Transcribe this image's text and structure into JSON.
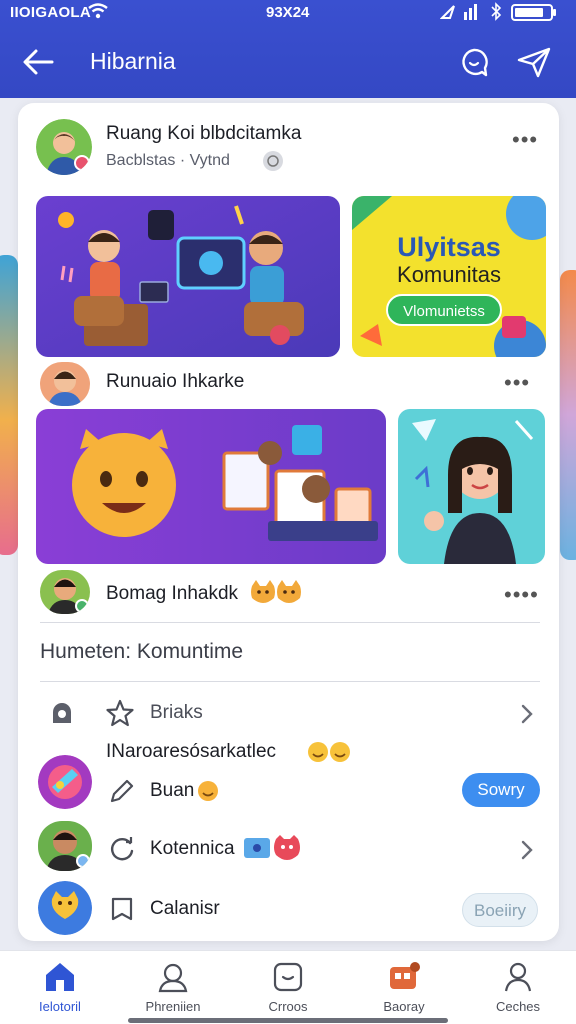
{
  "status_bar": {
    "carrier": "IIOIGAOLA",
    "time": "93X24",
    "icons": [
      "wifi-icon",
      "location-icon",
      "signal-icon",
      "bluetooth-icon",
      "battery-icon"
    ]
  },
  "header": {
    "title": "Hibarnia",
    "icons": [
      "back-arrow-icon",
      "chat-icon",
      "send-icon"
    ]
  },
  "posts": [
    {
      "title": "Ruang Koi blbdcitamka",
      "subtitle": "Bacblstas · Vytnd",
      "tiles": [
        {
          "kind": "illustration",
          "scene": "friends-with-computer"
        },
        {
          "kind": "promo",
          "heading": "Ulyitsas",
          "subheading": "Komunitas",
          "button": "Vlomunietss"
        }
      ]
    },
    {
      "title": "Runuaio Ihkarke",
      "tiles": [
        {
          "kind": "illustration",
          "scene": "emoji-and-documents"
        },
        {
          "kind": "illustration",
          "scene": "girl-with-music"
        }
      ]
    },
    {
      "title": "Bomag Inhakdk",
      "emoji": [
        "cat-face-icon",
        "cat-face-icon"
      ]
    }
  ],
  "section_title": "Humeten:  Komuntime",
  "list": [
    {
      "label": "Briaks",
      "left_icon": "person-silhouette-icon",
      "icon": "star-icon",
      "chevron": true
    },
    {
      "heading": "INaroaresósarkatlec",
      "label": "Buan",
      "icon": "pen-icon",
      "badge": "Sowry"
    },
    {
      "label": "Kotennica",
      "icon": "refresh-icon",
      "chevron": true
    },
    {
      "label": "Calanisr",
      "icon": "bookmark-icon",
      "badge": "Boeiiry"
    }
  ],
  "bottom_nav": [
    {
      "label": "Ielotoril",
      "icon": "home-icon",
      "active": true
    },
    {
      "label": "Phreniien",
      "icon": "profile-icon",
      "active": false
    },
    {
      "label": "Crroos",
      "icon": "message-icon",
      "active": false
    },
    {
      "label": "Baoray",
      "icon": "store-icon",
      "active": false
    },
    {
      "label": "Ceches",
      "icon": "person-icon",
      "active": false
    }
  ],
  "colors": {
    "brand": "#3a4fcf",
    "accent": "#3d8ef0",
    "card_background": "#ffffff",
    "page_background": "#e9ebf3"
  }
}
